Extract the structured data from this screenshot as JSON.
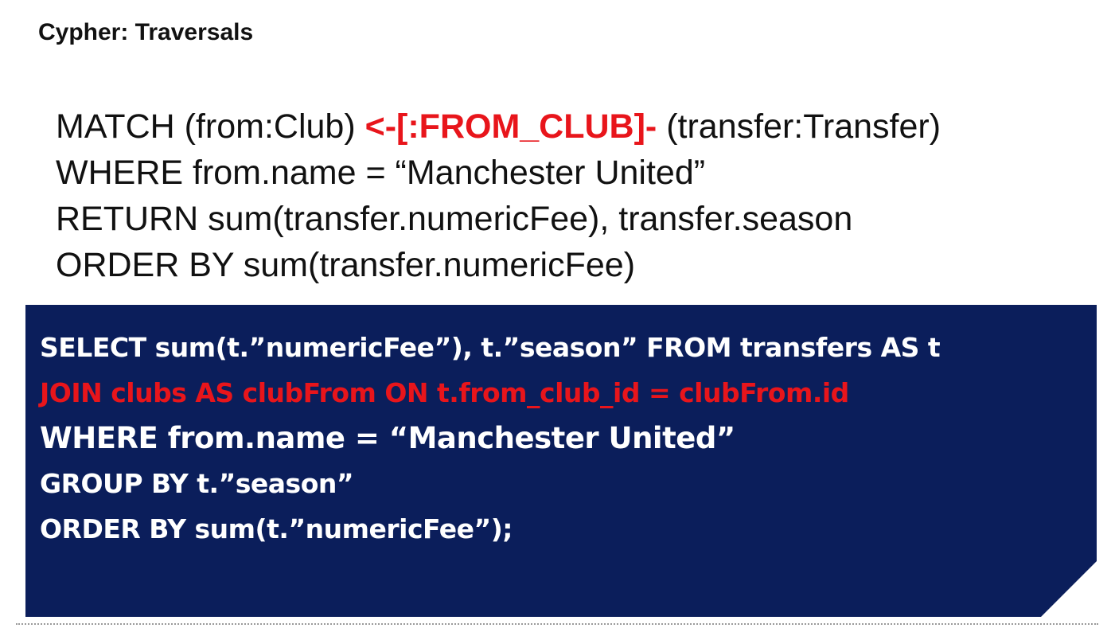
{
  "slide": {
    "title": "Cypher: Traversals"
  },
  "cypher": {
    "line1_pre": "MATCH (from:Club) ",
    "line1_highlight": "<-[:FROM_CLUB]-",
    "line1_post": " (transfer:Transfer)",
    "line2": "WHERE from.name = “Manchester United”",
    "line3": "RETURN sum(transfer.numericFee), transfer.season",
    "line4": "ORDER BY sum(transfer.numericFee)"
  },
  "sql": {
    "line1": "SELECT sum(t.”numericFee”), t.”season” FROM transfers AS t",
    "line2": "JOIN clubs AS clubFrom ON t.from_club_id = clubFrom.id",
    "line3": "WHERE from.name = “Manchester United”",
    "line4": "GROUP BY t.”season”",
    "line5": "ORDER BY sum(t.”numericFee”);"
  },
  "colors": {
    "highlight_red": "#e8151b",
    "sql_box_background": "#0b1e5b",
    "text_dark": "#111111",
    "text_white": "#ffffff"
  }
}
